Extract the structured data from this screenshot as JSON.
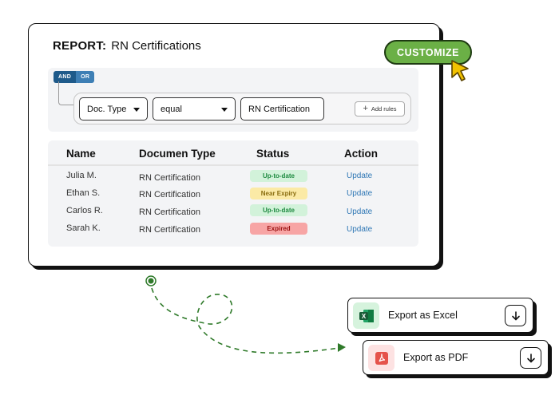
{
  "report": {
    "label": "REPORT:",
    "name": "RN Certifications"
  },
  "customize_label": "CUSTOMIZE",
  "filter": {
    "logic": [
      "AND",
      "OR"
    ],
    "field": "Doc. Type",
    "operator": "equal",
    "value": "RN Certification",
    "add_rules_label": "Add rules"
  },
  "table": {
    "headers": [
      "Name",
      "Documen Type",
      "Status",
      "Action"
    ],
    "rows": [
      {
        "name": "Julia M.",
        "doc_type": "RN Certification",
        "status": "Up-to-date",
        "action": "Update"
      },
      {
        "name": "Ethan S.",
        "doc_type": "RN Certification",
        "status": "Near Expiry",
        "action": "Update"
      },
      {
        "name": "Carlos R.",
        "doc_type": "RN Certification",
        "status": "Up-to-date",
        "action": "Update"
      },
      {
        "name": "Sarah K.",
        "doc_type": "RN Certification",
        "status": "Expired",
        "action": "Update"
      }
    ]
  },
  "exports": {
    "excel_label": "Export as Excel",
    "pdf_label": "Export as PDF"
  },
  "colors": {
    "accent_green": "#6bb046",
    "link_blue": "#2f77b5",
    "status_ok": "#d2f2da",
    "status_warn": "#fbeaa6",
    "status_bad": "#f7a5a5"
  }
}
